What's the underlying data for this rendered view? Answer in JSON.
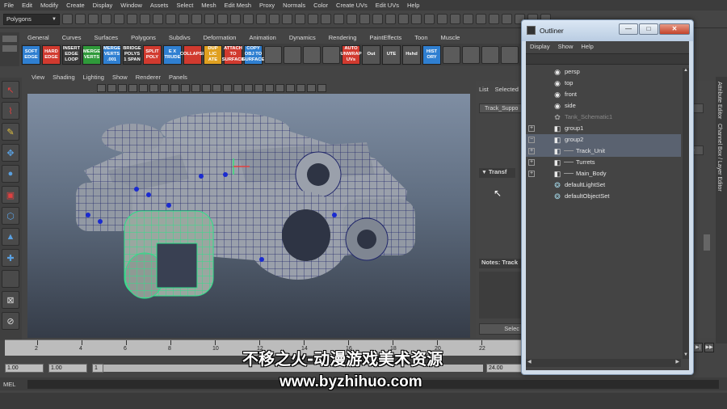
{
  "menubar": [
    "File",
    "Edit",
    "Modify",
    "Create",
    "Display",
    "Window",
    "Assets",
    "Select",
    "Mesh",
    "Edit Mesh",
    "Proxy",
    "Normals",
    "Color",
    "Create UVs",
    "Edit UVs",
    "Help"
  ],
  "status_line": {
    "mode": "Polygons"
  },
  "shelf": {
    "tabs": [
      "General",
      "Curves",
      "Surfaces",
      "Polygons",
      "Subdivs",
      "Deformation",
      "Animation",
      "Dynamics",
      "Rendering",
      "PaintEffects",
      "Toon",
      "Muscle"
    ],
    "buttons": [
      {
        "label": "SOFT EDGE",
        "color": "#2f7fd1"
      },
      {
        "label": "HARD EDGE",
        "color": "#d13a2f"
      },
      {
        "label": "INSERT EDGE LOOP",
        "color": "#3a3a3a"
      },
      {
        "label": "MERGE VERTS",
        "color": "#2f9a3a"
      },
      {
        "label": "MERGE VERTS .001",
        "color": "#2f7fd1"
      },
      {
        "label": "BRIDGE POLYS 1 SPAN",
        "color": "#3a3a3a"
      },
      {
        "label": "SPLIT POLY",
        "color": "#d13a2f"
      },
      {
        "label": "E X TRUDE",
        "color": "#2f7fd1"
      },
      {
        "label": "COLLAPSE",
        "color": "#d13a2f"
      },
      {
        "label": "DUP LIC ATE",
        "color": "#e0a020"
      },
      {
        "label": "ATTACH TO SURFACE",
        "color": "#d13a2f"
      },
      {
        "label": "COPY OBJ TO SURFACE",
        "color": "#2f7fd1"
      }
    ],
    "buttons2": [
      {
        "label": "AUTO UNWRAP UVs",
        "color": "#d13a2f"
      },
      {
        "label": "Out",
        "color": "#555555"
      },
      {
        "label": "UTE",
        "color": "#555555"
      },
      {
        "label": "Hshd",
        "color": "#555555"
      },
      {
        "label": "HIST ORY",
        "color": "#2f7fd1"
      }
    ]
  },
  "panel": {
    "menu": [
      "View",
      "Shading",
      "Lighting",
      "Show",
      "Renderer",
      "Panels"
    ]
  },
  "channel_box": {
    "tabs": [
      "List",
      "Selected"
    ],
    "field": "Track_Suppo",
    "section": "Transf",
    "notes": "Notes: Track",
    "select_label": "Selec",
    "right_labels": [
      "n3",
      "ode"
    ]
  },
  "side_tabs": [
    "Attribute Editor",
    "Channel Box / Layer Editor"
  ],
  "time_slider": {
    "ticks": [
      "2",
      "4",
      "6",
      "8",
      "10",
      "12",
      "14",
      "16",
      "18",
      "20",
      "22"
    ]
  },
  "range": {
    "start": "1.00",
    "start2": "1.00",
    "current": "1",
    "end": "24.00"
  },
  "command": {
    "label": "MEL"
  },
  "outliner": {
    "title": "Outliner",
    "menu": [
      "Display",
      "Show",
      "Help"
    ],
    "items": [
      {
        "label": "persp",
        "icon": "camera",
        "depth": 0,
        "expand": "",
        "selected": false,
        "dim": false
      },
      {
        "label": "top",
        "icon": "camera",
        "depth": 0,
        "expand": "",
        "selected": false,
        "dim": false
      },
      {
        "label": "front",
        "icon": "camera",
        "depth": 0,
        "expand": "",
        "selected": false,
        "dim": false
      },
      {
        "label": "side",
        "icon": "camera",
        "depth": 0,
        "expand": "",
        "selected": false,
        "dim": false
      },
      {
        "label": "Tank_Schematic1",
        "icon": "image",
        "depth": 0,
        "expand": "",
        "selected": false,
        "dim": true
      },
      {
        "label": "group1",
        "icon": "group",
        "depth": 0,
        "expand": "+",
        "selected": false,
        "dim": false
      },
      {
        "label": "group2",
        "icon": "group",
        "depth": 0,
        "expand": "−",
        "selected": true,
        "dim": false
      },
      {
        "label": "Track_Unit",
        "icon": "group",
        "depth": 1,
        "expand": "+",
        "selected": true,
        "dim": false
      },
      {
        "label": "Turrets",
        "icon": "group",
        "depth": 1,
        "expand": "+",
        "selected": false,
        "dim": false
      },
      {
        "label": "Main_Body",
        "icon": "group",
        "depth": 1,
        "expand": "+",
        "selected": false,
        "dim": false
      },
      {
        "label": "defaultLightSet",
        "icon": "set",
        "depth": 0,
        "expand": "",
        "selected": false,
        "dim": false
      },
      {
        "label": "defaultObjectSet",
        "icon": "set",
        "depth": 0,
        "expand": "",
        "selected": false,
        "dim": false
      }
    ]
  },
  "watermark": {
    "line1": "不移之火-动漫游戏美术资源",
    "line2": "www.byzhihuo.com"
  }
}
